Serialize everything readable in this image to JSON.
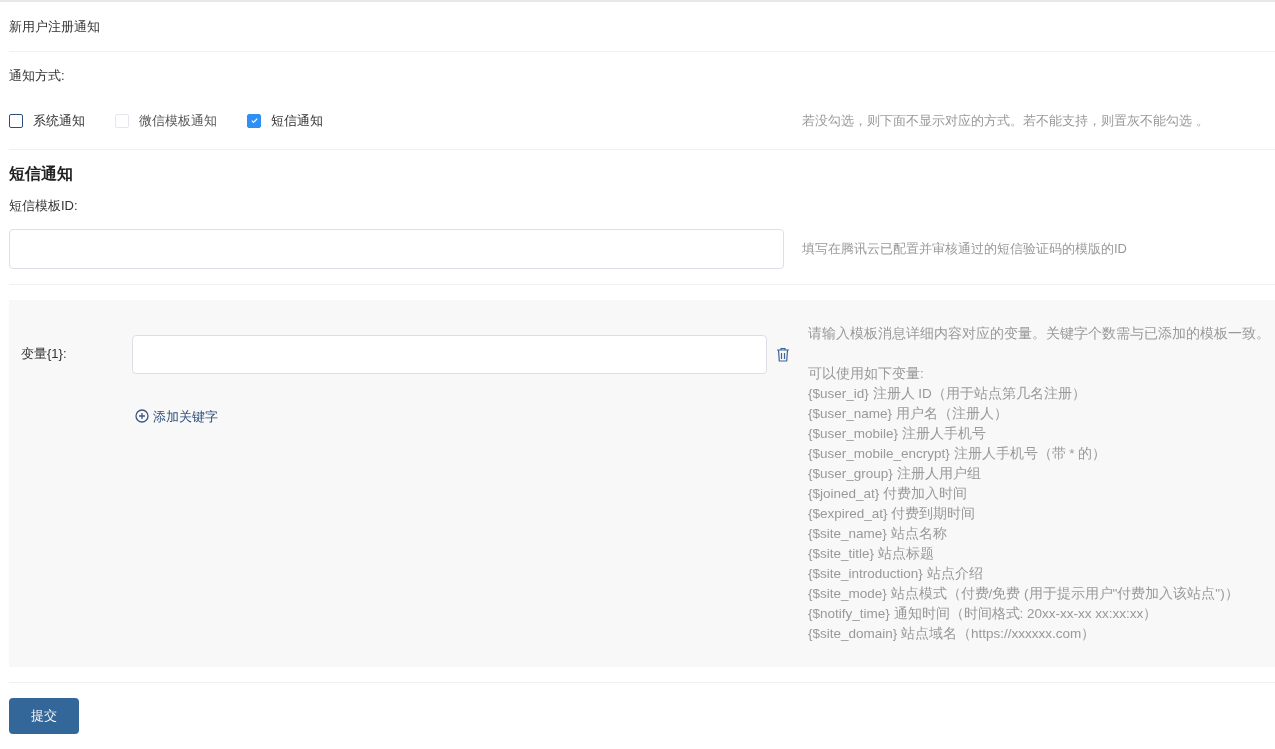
{
  "page_title": "新用户注册通知",
  "method_label": "通知方式:",
  "methods": [
    {
      "label": "系统通知",
      "checked": false,
      "disabled": false
    },
    {
      "label": "微信模板通知",
      "checked": false,
      "disabled": true
    },
    {
      "label": "短信通知",
      "checked": true,
      "disabled": false
    }
  ],
  "method_hint": "若没勾选，则下面不显示对应的方式。若不能支持，则置灰不能勾选 。",
  "sms": {
    "heading": "短信通知",
    "template_label": "短信模板ID:",
    "template_hint": "填写在腾讯云已配置并审核通过的短信验证码的模版的ID"
  },
  "variables": [
    {
      "label": "变量{1}:"
    }
  ],
  "add_keyword": "添加关键字",
  "variables_hint": "请输入模板消息详细内容对应的变量。关键字个数需与已添加的模板一致。",
  "available_title": "可以使用如下变量:",
  "available": [
    "{$user_id} 注册人 ID（用于站点第几名注册）",
    "{$user_name} 用户名（注册人）",
    "{$user_mobile} 注册人手机号",
    "{$user_mobile_encrypt} 注册人手机号（带 * 的）",
    "{$user_group} 注册人用户组",
    "{$joined_at} 付费加入时间",
    "{$expired_at} 付费到期时间",
    "{$site_name} 站点名称",
    "{$site_title} 站点标题",
    "{$site_introduction} 站点介绍",
    "{$site_mode} 站点模式（付费/免费 (用于提示用户\"付费加入该站点\")）",
    "{$notify_time} 通知时间（时间格式: 20xx-xx-xx xx:xx:xx）",
    "{$site_domain} 站点域名（https://xxxxxx.com）"
  ],
  "submit": "提交"
}
